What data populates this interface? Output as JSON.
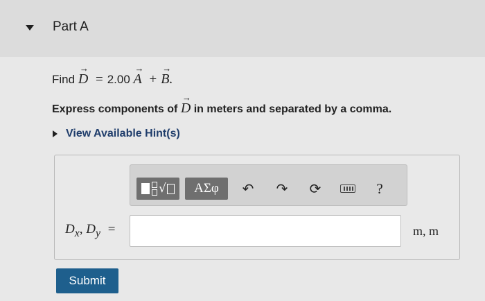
{
  "part": {
    "title": "Part A",
    "expanded_icon": "caret-down-icon"
  },
  "question": {
    "find_prefix": "Find",
    "vec_d": "D",
    "equals": "=",
    "coefficient": "2.00",
    "vec_a": "A",
    "plus": "+",
    "vec_b": "B",
    "period": ".",
    "instruction_pre": "Express components of",
    "instruction_vec": "D",
    "instruction_post": "in meters and separated by a comma."
  },
  "hint": {
    "label": "View Available Hint(s)",
    "icon": "caret-right-icon"
  },
  "toolbar": {
    "templates_icon": "templates-sqrt-icon",
    "symbols_label": "ΑΣφ",
    "undo_icon": "undo-icon",
    "redo_icon": "redo-icon",
    "reset_icon": "reset-icon",
    "keyboard_icon": "keyboard-icon",
    "help_label": "?"
  },
  "answer": {
    "label_dx": "Dx",
    "label_dy": "Dy",
    "separator": ",",
    "equals": "=",
    "value": "",
    "units": "m, m"
  },
  "submit": {
    "label": "Submit"
  },
  "colors": {
    "submit_bg": "#1e5f8d",
    "hint_text": "#1f3d6b",
    "toolbar_button": "#6f6f6f"
  }
}
